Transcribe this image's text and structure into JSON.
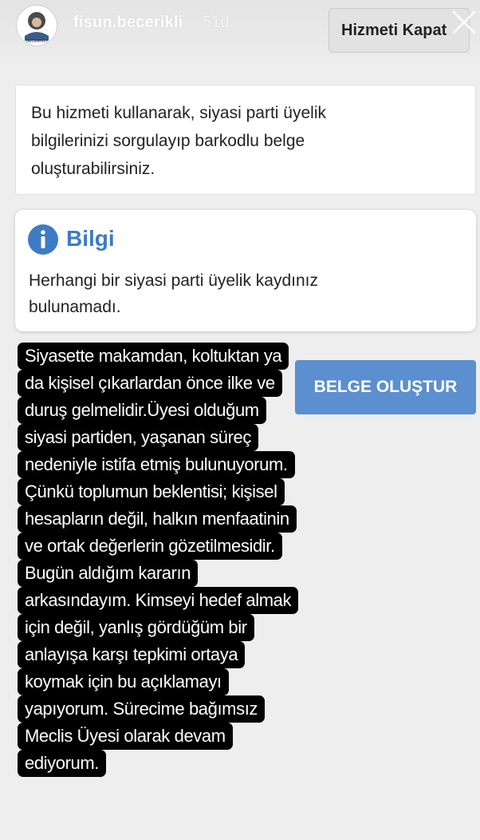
{
  "header": {
    "avatar_text": "BECERIKLI",
    "username": "fisun.becerikli",
    "time_ago": "51d",
    "close_service_label": "Hizmeti Kapat"
  },
  "intro_card": {
    "text": "Bu hizmeti kullanarak, siyasi parti üyelik bilgilerinizi sorgulayıp barkodlu belge oluşturabilirsiniz."
  },
  "info_card": {
    "title": "Bilgi",
    "message": "Herhangi bir siyasi parti üyelik kaydınız bulunamadı."
  },
  "create_document_label": "BELGE OLUŞTUR",
  "story_overlay": {
    "lines": [
      "Siyasette makamdan, koltuktan ya",
      "da kişisel çıkarlardan önce ilke ve",
      "duruş gelmelidir.Üyesi olduğum",
      "siyasi partiden, yaşanan süreç",
      "nedeniyle istifa etmiş bulunuyorum.",
      "Çünkü toplumun beklentisi; kişisel",
      "hesapların değil, halkın menfaatinin",
      "ve ortak değerlerin gözetilmesidir.",
      "Bugün aldığım kararın",
      "arkasındayım.  Kimseyi hedef almak",
      "için değil, yanlış gördüğüm bir",
      "anlayışa karşı tepkimi ortaya",
      "koymak için bu açıklamayı",
      "yapıyorum. Sürecime bağımsız",
      "Meclis Üyesi olarak devam",
      "ediyorum."
    ]
  },
  "colors": {
    "accent": "#3d7bc4",
    "button": "#5b8fcf",
    "page_background": "#eeeeee"
  }
}
